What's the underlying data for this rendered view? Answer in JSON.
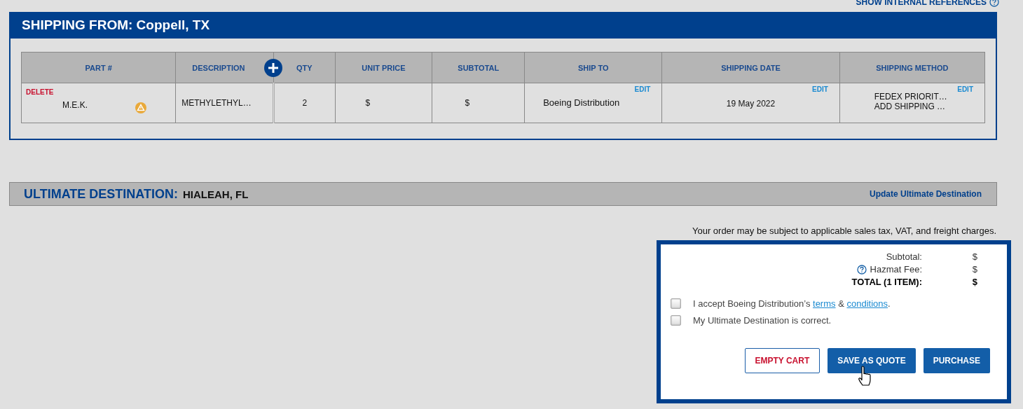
{
  "top_link": {
    "label": "SHOW INTERNAL REFERENCES"
  },
  "shipping_from": {
    "label": "SHIPPING FROM:",
    "location": "Coppell, TX"
  },
  "table": {
    "columns": [
      "PART #",
      "DESCRIPTION",
      "QTY",
      "UNIT PRICE",
      "SUBTOTAL",
      "SHIP TO",
      "SHIPPING DATE",
      "SHIPPING METHOD"
    ],
    "rows": [
      {
        "delete": "DELETE",
        "part": "M.E.K.",
        "hazmat": true,
        "description": "METHYLETHYL…",
        "qty": "2",
        "unit_price": "$",
        "subtotal": "$",
        "ship_to": "Boeing Distribution",
        "ship_to_edit": "EDIT",
        "shipping_date": "19 May 2022",
        "date_edit": "EDIT",
        "shipping_method": [
          "FEDEX PRIORIT…",
          "ADD SHIPPING …"
        ],
        "method_edit": "EDIT"
      }
    ]
  },
  "ultimate_destination": {
    "label": "ULTIMATE DESTINATION:",
    "value": "HIALEAH, FL",
    "link": "Update Ultimate Destination"
  },
  "tax_note": "Your order may be subject to applicable sales tax, VAT, and freight charges.",
  "summary": {
    "lines": [
      {
        "kind": "plain",
        "label": "Subtotal:",
        "value": "$"
      },
      {
        "kind": "help",
        "label": "Hazmat Fee:",
        "value": "$"
      },
      {
        "kind": "total",
        "label": "TOTAL (1 ITEM):",
        "value": "$"
      }
    ],
    "checks": [
      {
        "checked": false,
        "parts": [
          {
            "kind": "text",
            "text": "I accept Boeing Distribution’s "
          },
          {
            "kind": "link",
            "text": "terms"
          },
          {
            "kind": "text",
            "text": " & "
          },
          {
            "kind": "link",
            "text": "conditions"
          },
          {
            "kind": "text",
            "text": "."
          }
        ]
      },
      {
        "checked": false,
        "parts": [
          {
            "kind": "text",
            "text": "My Ultimate Destination is correct."
          }
        ]
      }
    ],
    "buttons": [
      {
        "label": "EMPTY CART",
        "kind": "outline"
      },
      {
        "label": "SAVE AS QUOTE",
        "kind": "primary"
      },
      {
        "label": "PURCHASE",
        "kind": "primary"
      }
    ]
  }
}
